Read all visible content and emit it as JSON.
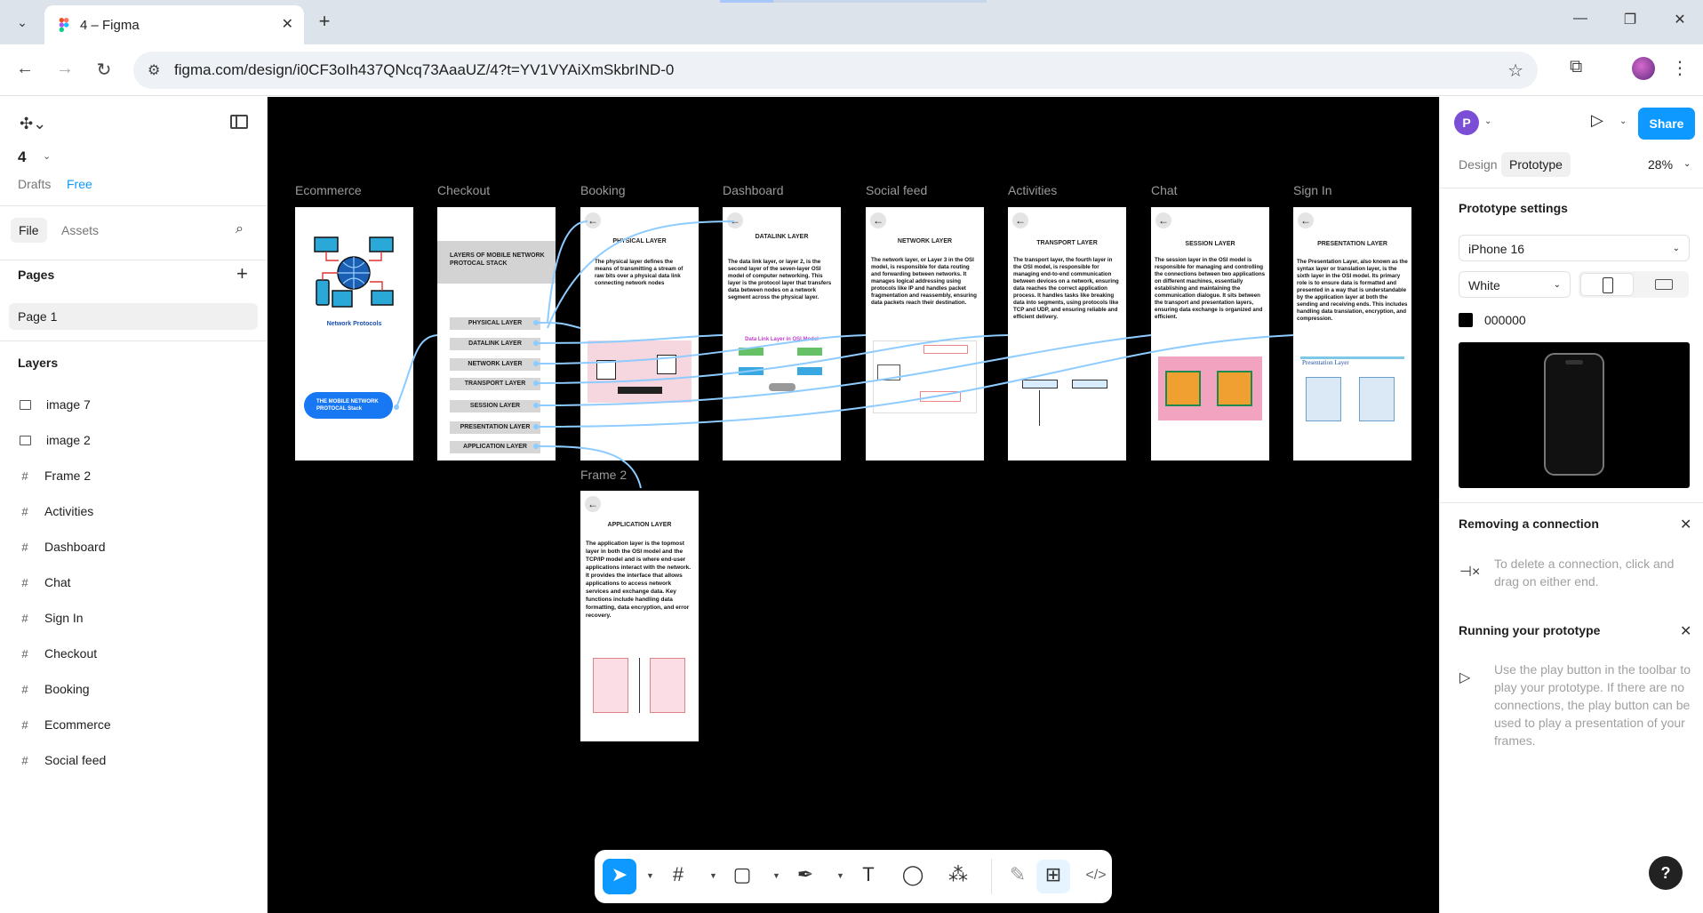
{
  "browser": {
    "tab_title": "4 – Figma",
    "url": "figma.com/design/i0CF3oIh437QNcq73AaaUZ/4?t=YV1VYAiXmSkbrIND-0"
  },
  "left_panel": {
    "file_name": "4",
    "drafts": "Drafts",
    "plan": "Free",
    "tab_file": "File",
    "tab_assets": "Assets",
    "pages_heading": "Pages",
    "current_page": "Page 1",
    "layers_heading": "Layers",
    "layers": [
      {
        "name": "image 7",
        "type": "image"
      },
      {
        "name": "image 2",
        "type": "image"
      },
      {
        "name": "Frame 2",
        "type": "frame"
      },
      {
        "name": "Activities",
        "type": "frame"
      },
      {
        "name": "Dashboard",
        "type": "frame"
      },
      {
        "name": "Chat",
        "type": "frame"
      },
      {
        "name": "Sign In",
        "type": "frame"
      },
      {
        "name": "Checkout",
        "type": "frame"
      },
      {
        "name": "Booking",
        "type": "frame"
      },
      {
        "name": "Ecommerce",
        "type": "frame"
      },
      {
        "name": "Social feed",
        "type": "frame"
      }
    ]
  },
  "canvas": {
    "frame_labels": [
      "Ecommerce",
      "Checkout",
      "Booking",
      "Dashboard",
      "Social feed",
      "Activities",
      "Chat",
      "Sign In",
      "Frame 2"
    ],
    "ecommerce": {
      "logo_text": "Network Protocols",
      "button": "THE MOBILE NETWORK PROTOCAL Stack"
    },
    "checkout": {
      "header": "LAYERS OF MOBILE NETWORK PROTOCAL STACK",
      "buttons": [
        "PHYSICAL LAYER",
        "DATALINK LAYER",
        "NETWORK LAYER",
        "TRANSPORT LAYER",
        "SESSION LAYER",
        "PRESENTATION LAYER",
        "APPLICATION LAYER"
      ]
    },
    "booking": {
      "title": "PHYSICAL LAYER",
      "text": "The physical layer defines the means of transmitting a stream of raw bits over a physical data link connecting network nodes"
    },
    "dashboard": {
      "title": "DATALINK LAYER",
      "text": "The data link layer, or layer 2, is the second layer of the seven-layer OSI model of computer networking. This layer is the protocol layer that transfers data between nodes on a network segment across the physical layer.",
      "img_title": "Data Link Layer in OSI Model"
    },
    "social": {
      "title": "NETWORK LAYER",
      "text": "The network layer, or Layer 3 in the OSI model, is responsible for data routing and forwarding between networks. It manages logical addressing using protocols like IP and handles packet fragmentation and reassembly, ensuring data packets reach their destination."
    },
    "activities": {
      "title": "TRANSPORT LAYER",
      "text": "The transport layer, the fourth layer in the OSI model, is responsible for managing end-to-end communication between devices on a network, ensuring data reaches the correct application process. It handles tasks like breaking data into segments, using protocols like TCP and UDP, and ensuring reliable and efficient delivery."
    },
    "chat": {
      "title": "SESSION LAYER",
      "text": "The session layer in the OSI model is responsible for managing and controlling the connections between two applications on different machines, essentially establishing and maintaining the communication dialogue. It sits between the transport and presentation layers, ensuring data exchange is organized and efficient."
    },
    "signin": {
      "title": "PRESENTATION LAYER",
      "text": "The Presentation Layer, also known as the syntax layer or translation layer, is the sixth layer in the OSI model. Its primary role is to ensure data is formatted and presented in a way that is understandable by the application layer at both the sending and receiving ends. This includes handling data translation, encryption, and compression.",
      "img_title": "Presentation Layer"
    },
    "frame2": {
      "title": "APPLICATION LAYER",
      "text": "The application layer is the topmost layer in both the OSI model and the TCP/IP model and is where end-user applications interact with the network. It provides the interface that allows applications to access network services and exchange data. Key functions include handling data formatting, data encryption, and error recovery."
    }
  },
  "right_panel": {
    "avatar_letter": "P",
    "share": "Share",
    "tab_design": "Design",
    "tab_prototype": "Prototype",
    "zoom": "28%",
    "settings_heading": "Prototype settings",
    "device": "iPhone 16",
    "model_color": "White",
    "background_hex": "000000",
    "removing_heading": "Removing a connection",
    "removing_hint": "To delete a connection, click and drag on either end.",
    "running_heading": "Running your prototype",
    "running_hint": "Use the play button in the toolbar to play your prototype. If there are no connections, the play button can be used to play a presentation of your frames."
  },
  "colors": {
    "figma_blue": "#0d99ff",
    "connector": "#8ecbff",
    "canvas_bg": "#000000"
  }
}
